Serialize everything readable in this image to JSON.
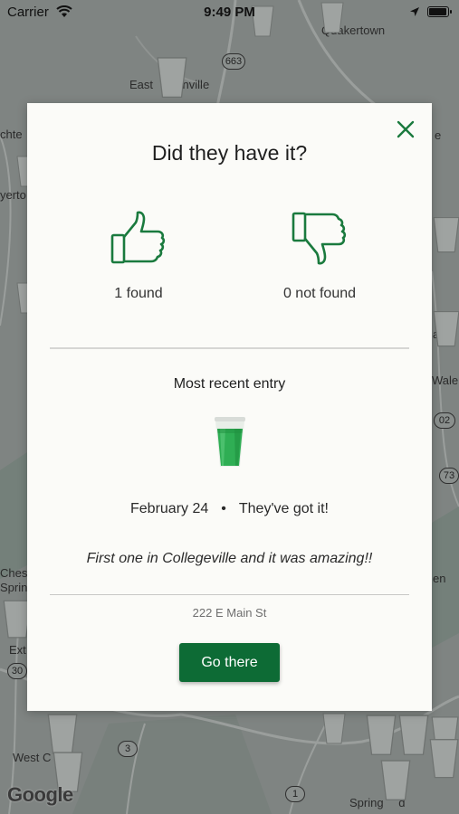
{
  "status_bar": {
    "carrier": "Carrier",
    "time": "9:49 PM",
    "battery_level": 1.0
  },
  "map": {
    "labels": [
      "Quakertown",
      "East Greenville",
      "West Chester",
      "Springfield"
    ],
    "shown_text": {
      "east": "East",
      "ville": "nville",
      "west": "West C",
      "er": "er",
      "spring": "Spring",
      "d": "d",
      "left_edge_1": "chte",
      "left_edge_2": "yerto",
      "left_edge_3": "Chest",
      "left_edge_4": "Sprin",
      "left_edge_5": "Ext",
      "right_edge_1": "e",
      "right_edge_2": "Wale",
      "right_edge_3": "a",
      "right_edge_4": "en"
    },
    "route_shields": [
      "663",
      "02",
      "73",
      "30",
      "3",
      "1"
    ],
    "attribution": "Google"
  },
  "modal": {
    "title": "Did they have it?",
    "found_label": "1 found",
    "not_found_label": "0 not found",
    "section_title": "Most recent entry",
    "entry_date": "February 24",
    "separator": "•",
    "entry_status": "They've got it!",
    "entry_comment": "First one in Collegeville and it was amazing!!",
    "address": "222 E Main St",
    "go_button_label": "Go there"
  },
  "colors": {
    "brand_green": "#0d6b35",
    "icon_green": "#1a7a3e",
    "drink_green": "#2fae54"
  },
  "icons": {
    "close": "close-icon",
    "thumbs_up": "thumbs-up-icon",
    "thumbs_down": "thumbs-down-icon",
    "wifi": "wifi-icon",
    "location": "location-arrow-icon",
    "battery": "battery-icon"
  }
}
